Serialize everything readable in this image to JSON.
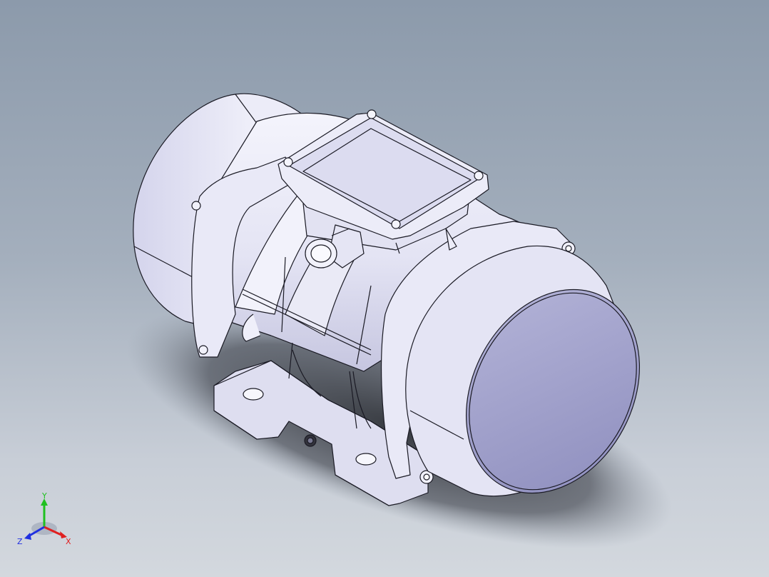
{
  "viewport": {
    "background_top": "#8c9aab",
    "background_bottom": "#d3d8de",
    "model": "vibration-motor"
  },
  "colors": {
    "body_fill": "#e7e7f6",
    "body_shade": "#c9c9e2",
    "cap_face": "#9c9cc8",
    "edge": "#1a1a24",
    "shadow": "#3e4149"
  },
  "triad": {
    "x_label": "X",
    "y_label": "Y",
    "z_label": "Z",
    "x_color": "#e02020",
    "y_color": "#20c020",
    "z_color": "#2030e0"
  }
}
